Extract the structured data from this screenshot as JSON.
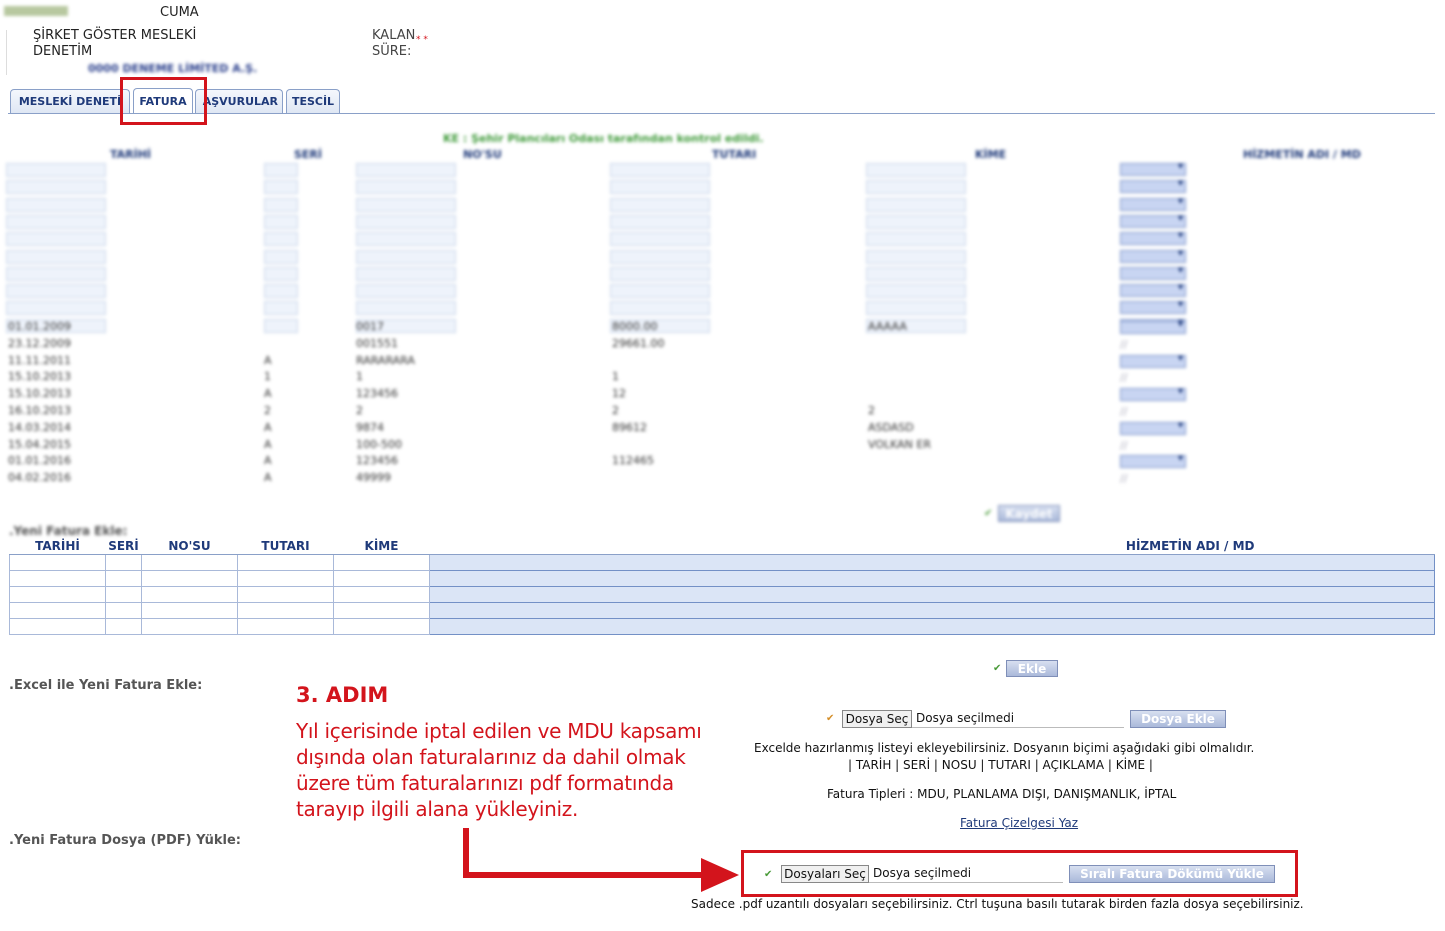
{
  "header": {
    "day": "CUMA",
    "company_label": "ŞİRKET GÖSTER MESLEKİ DENETİM",
    "company_line1": "ŞİRKET GÖSTER MESLEKİ",
    "company_line2": "DENETİM",
    "remaining_label_1": "KALAN",
    "remaining_label_2": "SÜRE:",
    "remaining_marker": "* *",
    "company_name": "0000 DENEME LİMİTED A.Ş."
  },
  "tabs": [
    {
      "label": "MESLEKİ DENETİM",
      "display": "MESLEKİ DENETİ",
      "active": false
    },
    {
      "label": "FATURA",
      "active": true
    },
    {
      "label": "BAŞVURULAR",
      "display": "AŞVURULAR",
      "active": false
    },
    {
      "label": "TESCİL",
      "active": false
    }
  ],
  "invoice_grid": {
    "notice": "KE : Şehir Plancıları Odası tarafından kontrol edildi.",
    "columns": [
      "TARİHİ",
      "SERİ",
      "NO'SU",
      "TUTARI",
      "KİME",
      "HİZMETİN ADI / MD"
    ],
    "rows": [
      {
        "date": "01.01.2009",
        "serial": "",
        "no": "0017",
        "amount": "8000.00",
        "to": "AAAAA"
      },
      {
        "date": "23.12.2009",
        "serial": "",
        "no": "001551",
        "amount": "29661.00",
        "to": ""
      },
      {
        "date": "11.11.2011",
        "serial": "A",
        "no": "RARARARA",
        "amount": "",
        "to": ""
      },
      {
        "date": "15.10.2013",
        "serial": "1",
        "no": "1",
        "amount": "1",
        "to": ""
      },
      {
        "date": "15.10.2013",
        "serial": "A",
        "no": "123456",
        "amount": "12",
        "to": ""
      },
      {
        "date": "16.10.2013",
        "serial": "2",
        "no": "2",
        "amount": "2",
        "to": "2"
      },
      {
        "date": "14.03.2014",
        "serial": "A",
        "no": "9874",
        "amount": "89612",
        "to": "ASDASD"
      },
      {
        "date": "15.04.2015",
        "serial": "A",
        "no": "100-500",
        "amount": "",
        "to": "VOLKAN ER"
      },
      {
        "date": "01.01.2016",
        "serial": "A",
        "no": "123456",
        "amount": "112465",
        "to": ""
      },
      {
        "date": "04.02.2016",
        "serial": "A",
        "no": "49999",
        "amount": "",
        "to": ""
      }
    ],
    "save_label": "Kaydet"
  },
  "new_invoice": {
    "section_label": ".Yeni Fatura Ekle:",
    "columns": [
      "TARİHİ",
      "SERİ",
      "NO'SU",
      "TUTARI",
      "KİME",
      "HİZMETİN ADI / MD"
    ],
    "add_label": "Ekle"
  },
  "excel_section": {
    "label": ".Excel ile Yeni Fatura Ekle:",
    "choose_label": "Dosya Seç",
    "no_file": "Dosya seçilmedi",
    "add_file_label": "Dosya Ekle",
    "info_line1": "Excelde hazırlanmış listeyi ekleyebilirsiniz. Dosyanın biçimi aşağıdaki gibi olmalıdır.",
    "info_line2": "| TARİH | SERİ | NOSU | TUTARI | AÇIKLAMA | KİME |",
    "types_line": "Fatura Tipleri : MDU, PLANLAMA DIŞI, DANIŞMANLIK, İPTAL",
    "write_list_link": "Fatura Çizelgesi Yaz"
  },
  "pdf_section": {
    "label": ".Yeni Fatura Dosya (PDF) Yükle:",
    "choose_label": "Dosyaları Seç",
    "no_file": "Dosya seçilmedi",
    "upload_label": "Sıralı Fatura Dökümü Yükle",
    "hint": "Sadece .pdf uzantılı dosyaları seçebilirsiniz. Ctrl tuşuna basılı tutarak birden fazla dosya seçebilirsiniz."
  },
  "annotation": {
    "title": "3. ADIM",
    "text": "Yıl içerisinde iptal edilen ve MDU kapsamı dışında olan faturalarınız da dahil olmak üzere tüm faturalarınızı pdf formatında tarayıp ilgili alana yükleyiniz.",
    "color": "#d3141c"
  },
  "colors": {
    "link": "#1f3a7a",
    "accent": "#d3141c",
    "field": "#dbe5f6"
  }
}
